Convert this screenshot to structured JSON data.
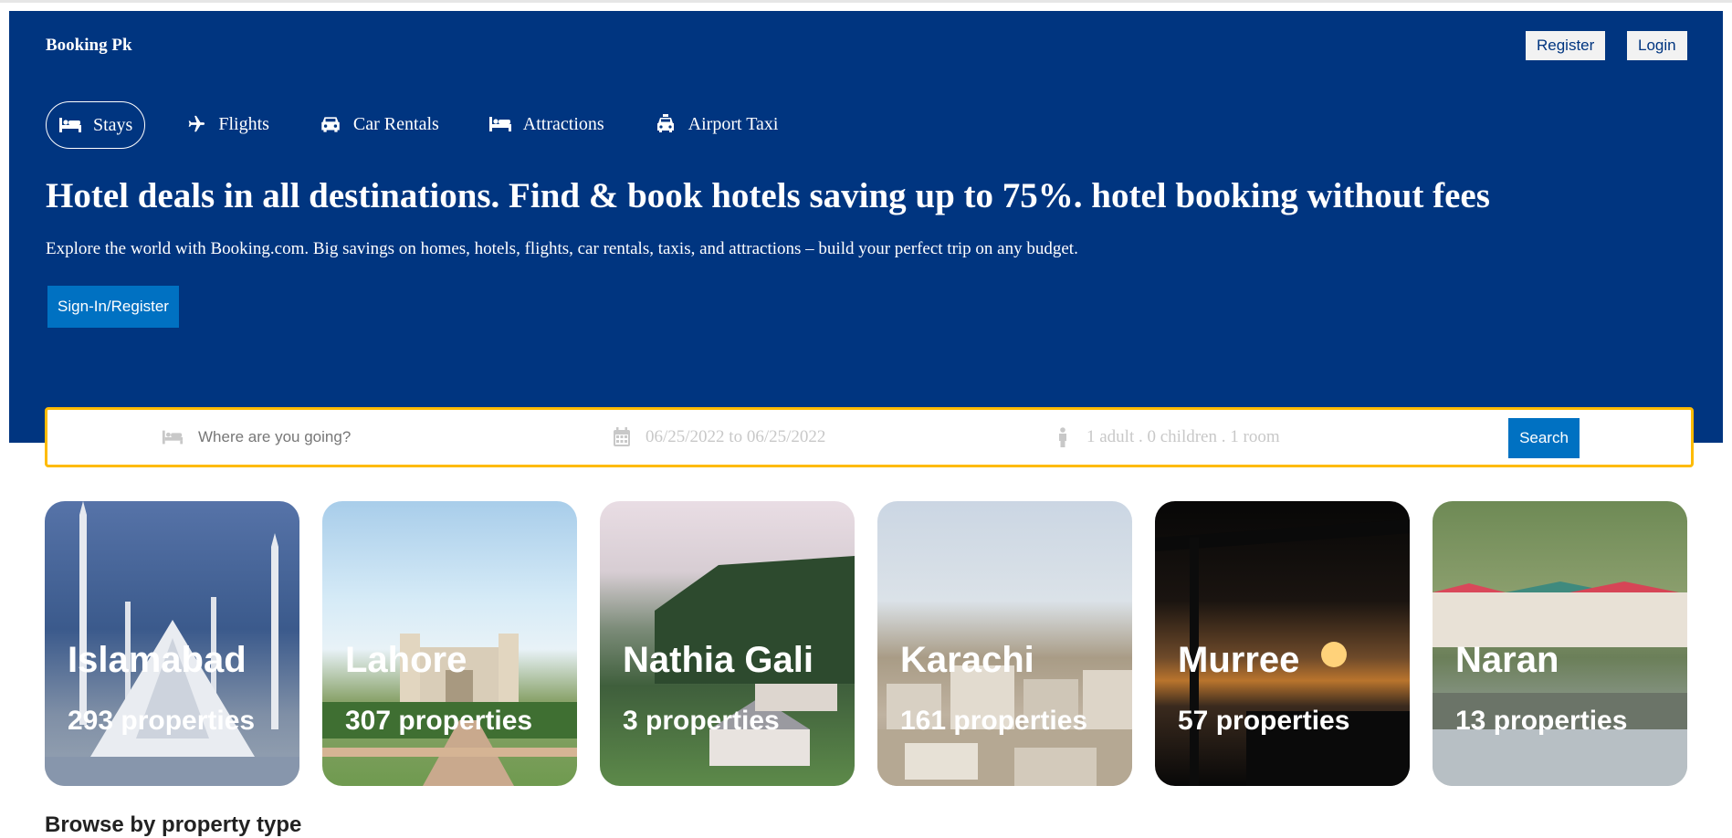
{
  "header": {
    "logo": "Booking Pk",
    "register_label": "Register",
    "login_label": "Login",
    "tabs": [
      {
        "label": "Stays",
        "icon": "bed-icon",
        "active": true
      },
      {
        "label": "Flights",
        "icon": "plane-icon"
      },
      {
        "label": "Car Rentals",
        "icon": "car-icon"
      },
      {
        "label": "Attractions",
        "icon": "bed-icon"
      },
      {
        "label": "Airport Taxi",
        "icon": "taxi-icon"
      }
    ],
    "headline": "Hotel deals in all destinations. Find & book hotels saving up to 75%. hotel booking without fees",
    "subtext": "Explore the world with Booking.com. Big savings on homes, hotels, flights, car rentals, taxis, and attractions – build your perfect trip on any budget.",
    "signin_label": "Sign-In/Register"
  },
  "search": {
    "destination_placeholder": "Where are you going?",
    "dates": "06/25/2022 to 06/25/2022",
    "guests": "1 adult . 0 children . 1 room",
    "button_label": "Search"
  },
  "cities": [
    {
      "name": "Islamabad",
      "count": "293 properties"
    },
    {
      "name": "Lahore",
      "count": "307 properties"
    },
    {
      "name": "Nathia Gali",
      "count": "3 properties"
    },
    {
      "name": "Karachi",
      "count": "161 properties"
    },
    {
      "name": "Murree",
      "count": "57 properties"
    },
    {
      "name": "Naran",
      "count": "13 properties"
    }
  ],
  "browse_title": "Browse by property type",
  "colors": {
    "brand_blue": "#003580",
    "button_blue": "#0071c2",
    "search_border": "#febb02"
  }
}
